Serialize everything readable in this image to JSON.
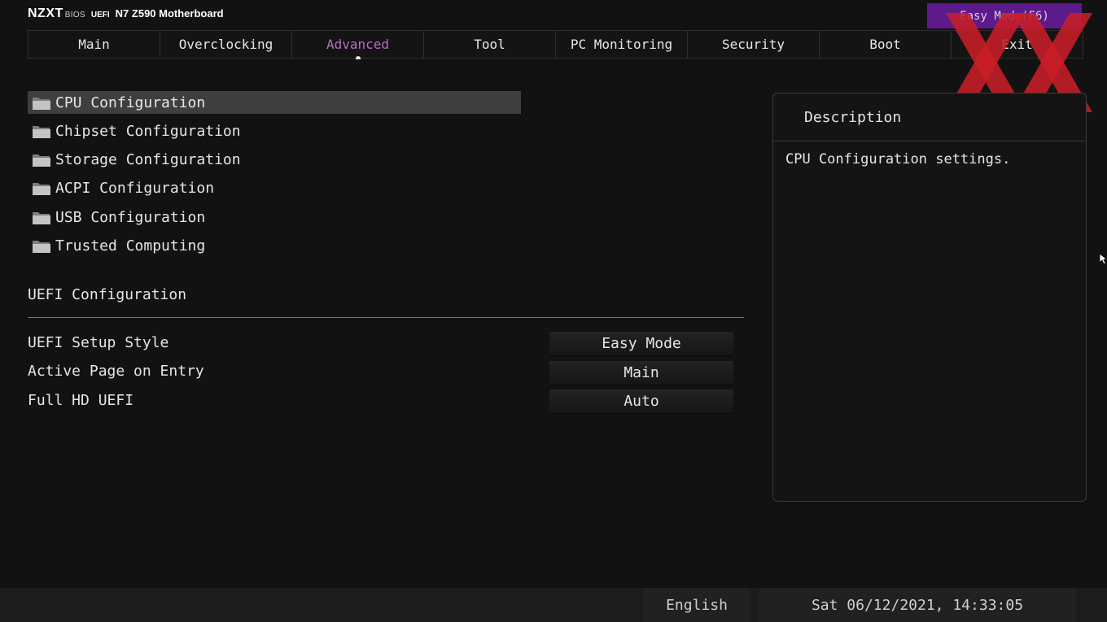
{
  "header": {
    "brand": "NZXT",
    "bios": "BIOS",
    "uefi": "UEFI",
    "model": "N7 Z590 Motherboard",
    "easy_mode_button": "Easy Mode(F6)"
  },
  "tabs": [
    "Main",
    "Overclocking",
    "Advanced",
    "Tool",
    "PC Monitoring",
    "Security",
    "Boot",
    "Exit"
  ],
  "active_tab": "Advanced",
  "menu": [
    {
      "label": "CPU Configuration",
      "selected": true
    },
    {
      "label": "Chipset Configuration",
      "selected": false
    },
    {
      "label": "Storage Configuration",
      "selected": false
    },
    {
      "label": "ACPI Configuration",
      "selected": false
    },
    {
      "label": "USB Configuration",
      "selected": false
    },
    {
      "label": "Trusted Computing",
      "selected": false
    }
  ],
  "uefi_section": {
    "title": "UEFI Configuration",
    "options": [
      {
        "label": "UEFI Setup Style",
        "value": "Easy Mode"
      },
      {
        "label": "Active Page on Entry",
        "value": "Main"
      },
      {
        "label": "Full HD UEFI",
        "value": "Auto"
      }
    ]
  },
  "description": {
    "title": "Description",
    "text": "CPU Configuration settings."
  },
  "footer": {
    "language": "English",
    "datetime": "Sat 06/12/2021, 14:33:05"
  },
  "colors": {
    "accent_purple": "#5d1a8a",
    "active_tab": "#b46ec8",
    "background": "#121212",
    "selected_row": "#3f3f3f",
    "watermark_red": "#c81e28"
  },
  "icons": {
    "menu_item": "folder-icon",
    "watermark": "xx-watermark-icon",
    "pointer": "mouse-cursor-icon"
  }
}
